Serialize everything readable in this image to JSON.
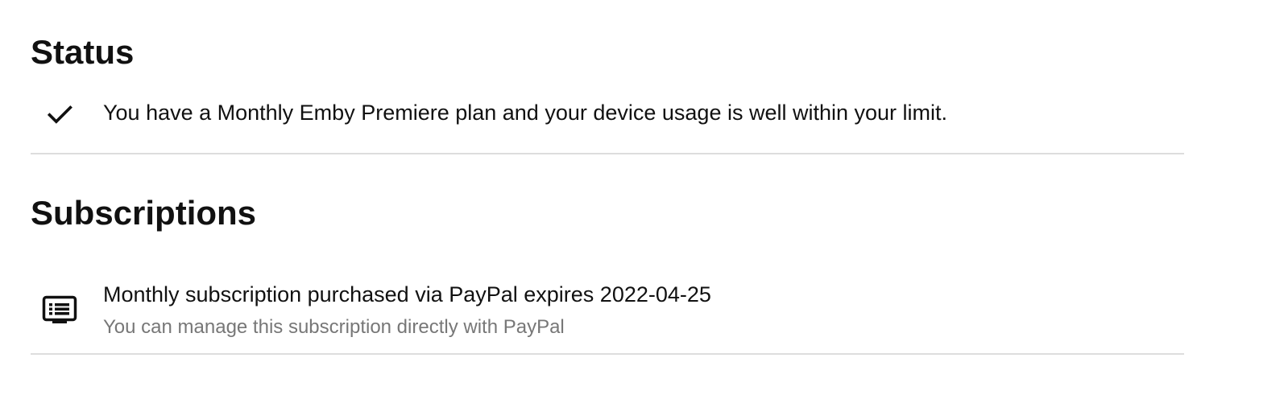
{
  "status": {
    "title": "Status",
    "message": "You have a Monthly Emby Premiere plan and your device usage is well within your limit.",
    "icon": "check-icon"
  },
  "subscriptions": {
    "title": "Subscriptions",
    "items": [
      {
        "icon": "subscription-list-icon",
        "title": "Monthly subscription purchased via PayPal expires 2022-04-25",
        "subtitle": "You can manage this subscription directly with PayPal"
      }
    ]
  },
  "colors": {
    "text": "#111111",
    "secondary_text": "#777777",
    "divider": "#dddddd",
    "background": "#ffffff"
  }
}
